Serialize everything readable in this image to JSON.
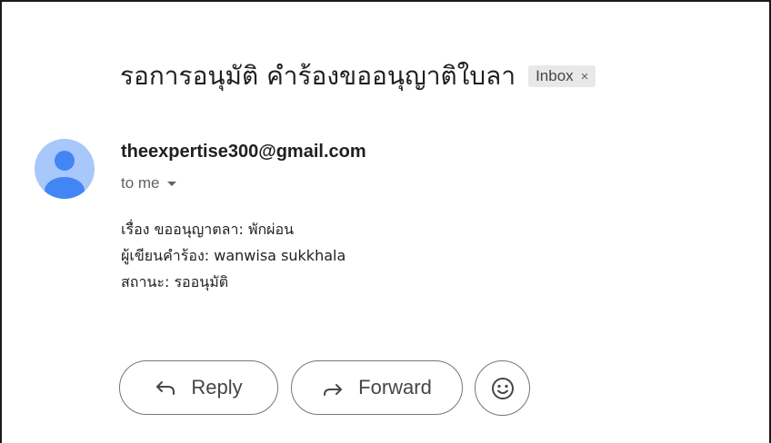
{
  "email": {
    "subject": "รอการอนุมัติ คำร้องขออนุญาติใบลา",
    "label_badge": "Inbox",
    "label_remove": "×",
    "sender": "theexpertise300@gmail.com",
    "recipient_line": "to me",
    "body_lines": [
      "เรื่อง ขออนุญาตลา: พักผ่อน",
      "ผู้เขียนคำร้อง: wanwisa sukkhala",
      "สถานะ: รออนุมัติ"
    ]
  },
  "actions": {
    "reply_label": "Reply",
    "forward_label": "Forward"
  },
  "icons": {
    "reply": "reply-arrow-icon",
    "forward": "forward-arrow-icon",
    "emoji": "smiley-icon",
    "avatar": "person-icon",
    "expand": "caret-down-icon"
  },
  "colors": {
    "avatar_bg": "#a8c7fa",
    "avatar_fg": "#4285f4",
    "badge_bg": "#e8e8e8"
  }
}
